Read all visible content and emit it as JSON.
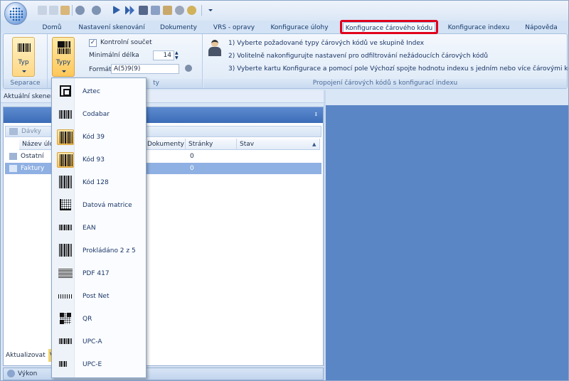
{
  "tabs": [
    {
      "label": "Domů"
    },
    {
      "label": "Nastavení skenování"
    },
    {
      "label": "Dokumenty"
    },
    {
      "label": "VRS - opravy"
    },
    {
      "label": "Konfigurace úlohy"
    },
    {
      "label": "Konfigurace čárového kódu"
    },
    {
      "label": "Konfigurace indexu"
    },
    {
      "label": "Nápověda"
    }
  ],
  "active_tab": "Konfigurace čárového kódu",
  "ribbon": {
    "separace": {
      "button_label": "Typ",
      "group_label": "Separace"
    },
    "typy": {
      "button_label": "Typy"
    },
    "kontrolni_soucet": {
      "label": "Kontrolní součet",
      "checked": true
    },
    "min_delka": {
      "label": "Minimální délka",
      "value": "14"
    },
    "format": {
      "label": "Formát",
      "value": "A(5)9(9)"
    },
    "instructions": [
      "1) Vyberte požadované typy čárových kódů ve skupině Index",
      "2) Volitelně nakonfigurujte nastavení pro odfiltrování nežádoucích čárových kódů",
      "3) Vyberte kartu Konfigurace a pomocí pole Výchozí spojte hodnotu indexu s jedním nebo více čárovými kódy"
    ],
    "propojeni_group_label": "Propojení čárových kódů s konfigurací indexu",
    "group2_label_fragment": "ty"
  },
  "left_pane": {
    "title": "Aktuální skener",
    "toolbar_label": "Dávky",
    "columns": [
      "Název úlo",
      "Dokumenty",
      "Stránky",
      "Stav"
    ],
    "rows": [
      {
        "name": "Ostatní",
        "pages": "0",
        "selected": false
      },
      {
        "name": "Faktury",
        "pages": "0",
        "selected": true
      }
    ],
    "bottom_tab": "Aktualizovat",
    "bottom_tab2": "V",
    "vykon_label": "Výkon"
  },
  "menu": {
    "items": [
      {
        "label": "Aztec",
        "icon": "aztec-icon",
        "checked": false
      },
      {
        "label": "Codabar",
        "icon": "barcode-icon",
        "checked": false
      },
      {
        "label": "Kód 39",
        "icon": "barcode-icon",
        "checked": true
      },
      {
        "label": "Kód 93",
        "icon": "barcode-icon",
        "checked": true
      },
      {
        "label": "Kód 128",
        "icon": "barcode-icon",
        "checked": false
      },
      {
        "label": "Datová matrice",
        "icon": "datamatrix-icon",
        "checked": false
      },
      {
        "label": "EAN",
        "icon": "barcode-icon",
        "checked": false
      },
      {
        "label": "Prokládáno 2 z 5",
        "icon": "barcode-icon",
        "checked": false
      },
      {
        "label": "PDF 417",
        "icon": "pdf417-icon",
        "checked": false
      },
      {
        "label": "Post Net",
        "icon": "postnet-icon",
        "checked": false
      },
      {
        "label": "QR",
        "icon": "qr-icon",
        "checked": false
      },
      {
        "label": "UPC-A",
        "icon": "barcode-icon",
        "checked": false
      },
      {
        "label": "UPC-E",
        "icon": "barcode-icon",
        "checked": false
      }
    ]
  },
  "colors": {
    "highlight_border": "#e0001b",
    "workspace_blue": "#5b86c6",
    "selected_row": "#8fb0e3",
    "checked_item": "#ffc65c"
  }
}
